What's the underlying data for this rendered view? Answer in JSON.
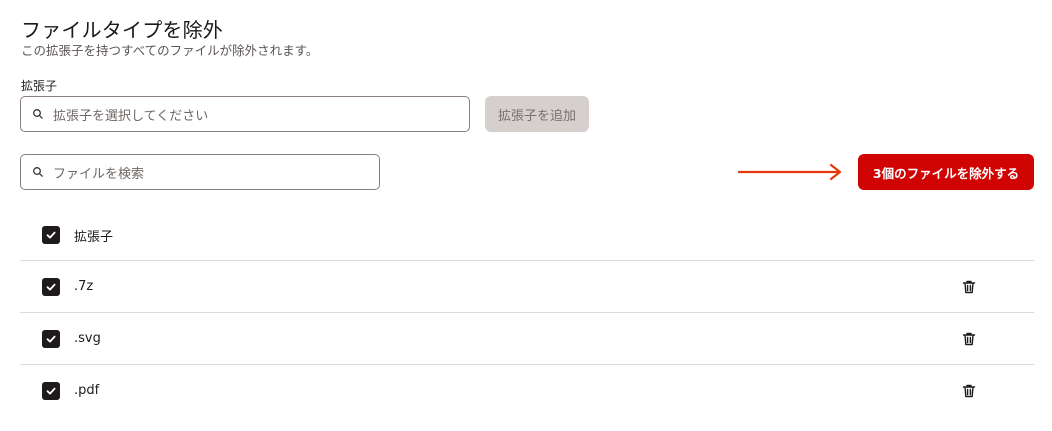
{
  "dialog": {
    "title": "ファイルタイプを除外",
    "subtitle": "この拡張子を持つすべてのファイルが除外されます。"
  },
  "extension_field": {
    "label": "拡張子",
    "placeholder": "拡張子を選択してください",
    "add_button": "拡張子を追加"
  },
  "file_search": {
    "placeholder": "ファイルを検索"
  },
  "exclude_button": "3個のファイルを除外する",
  "colors": {
    "accent": "#d10404",
    "arrow": "#e8380d",
    "disabled_button": "#d5cfcd"
  },
  "table": {
    "header": {
      "label": "拡張子",
      "checked": true
    },
    "rows": [
      {
        "label": ".7z",
        "checked": true
      },
      {
        "label": ".svg",
        "checked": true
      },
      {
        "label": ".pdf",
        "checked": true
      }
    ]
  }
}
